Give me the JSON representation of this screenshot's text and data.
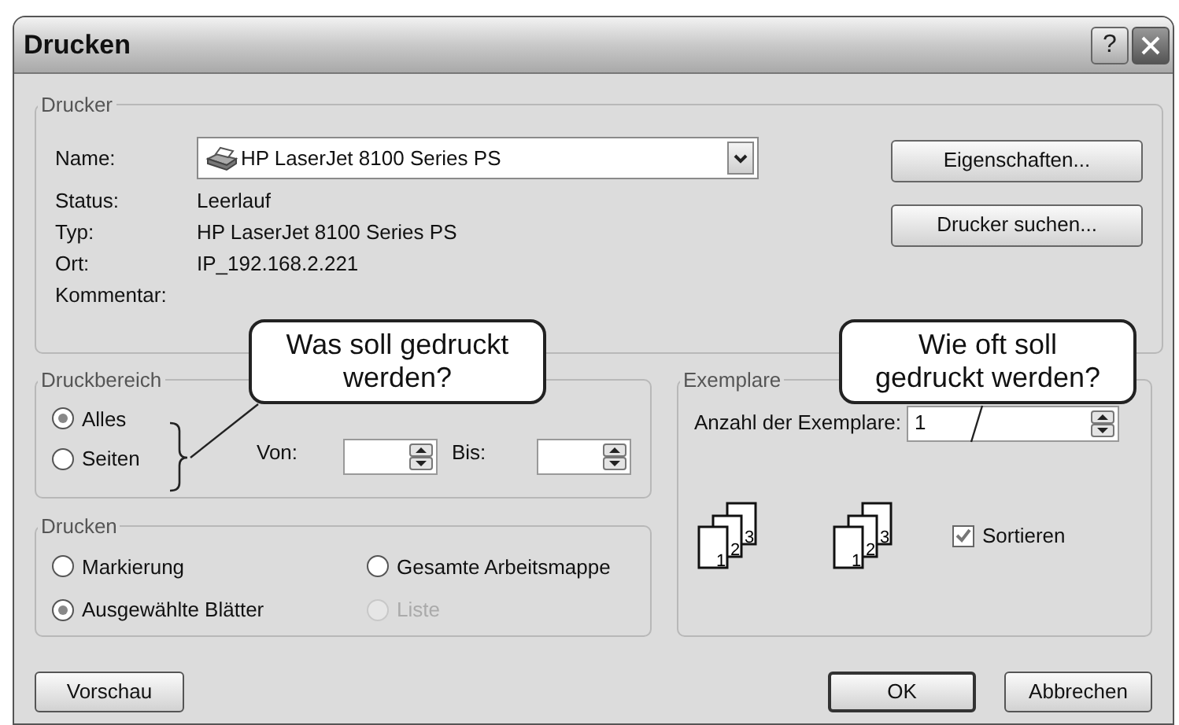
{
  "window": {
    "title": "Drucken",
    "help_button": "?"
  },
  "printer": {
    "title": "Drucker",
    "name_label": "Name:",
    "name_value": "HP LaserJet 8100 Series PS",
    "fields": [
      {
        "label": "Status:",
        "value": "Leerlauf"
      },
      {
        "label": "Typ:",
        "value": "HP LaserJet 8100 Series PS"
      },
      {
        "label": "Ort:",
        "value": "IP_192.168.2.221"
      },
      {
        "label": "Kommentar:"
      }
    ],
    "buttons": [
      "Eigenschaften...",
      "Drucker suchen..."
    ]
  },
  "print_range": {
    "title": "Druckbereich",
    "options": [
      {
        "label": "Alles",
        "selected": true
      },
      {
        "label": "Seiten",
        "selected": false
      }
    ],
    "from_label": "Von:",
    "to_label": "Bis:"
  },
  "print_what": {
    "title": "Drucken",
    "options": [
      {
        "label": "Markierung",
        "selected": false,
        "disabled": false
      },
      {
        "label": "Gesamte Arbeitsmappe",
        "selected": false,
        "disabled": false
      },
      {
        "label": "Ausgewählte Blätter",
        "selected": true,
        "disabled": false
      },
      {
        "label": "Liste",
        "selected": false,
        "disabled": true
      }
    ]
  },
  "copies": {
    "title": "Exemplare",
    "count_label": "Anzahl der Exemplare:",
    "count": "1",
    "stacks": [
      {
        "pages": [
          "1",
          "2",
          "3"
        ]
      },
      {
        "pages": [
          "1",
          "2",
          "3"
        ]
      }
    ],
    "collate": {
      "label": "Sortieren",
      "checked": true
    }
  },
  "buttons": [
    {
      "label": "Vorschau",
      "default": false
    },
    {
      "label": "OK",
      "default": true
    },
    {
      "label": "Abbrechen",
      "default": false
    }
  ],
  "callouts": [
    {
      "lines": [
        "Was soll gedruckt",
        "werden?"
      ]
    },
    {
      "lines": [
        "Wie oft soll",
        "gedruckt werden?"
      ]
    }
  ]
}
